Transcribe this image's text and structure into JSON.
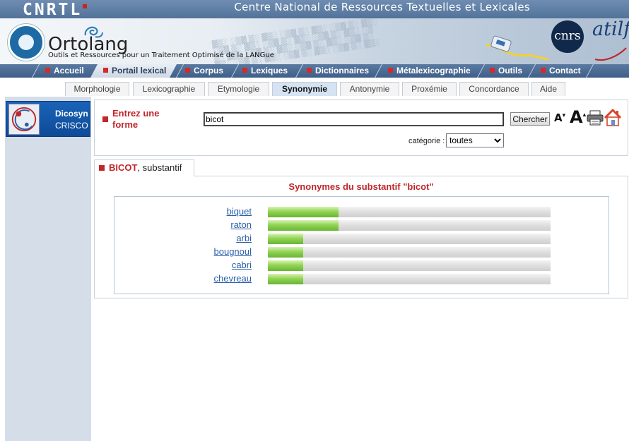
{
  "header": {
    "logo": "CNRTL",
    "title": "Centre National de Ressources Textuelles et Lexicales",
    "ortolang": "Ortolang",
    "tagline": "Outils et Ressources pour un Traitement Optimisé de la LANGue",
    "cnrs": "cnrs",
    "atilf": "atilf"
  },
  "nav": [
    {
      "label": "Accueil",
      "active": false
    },
    {
      "label": "Portail lexical",
      "active": true
    },
    {
      "label": "Corpus",
      "active": false
    },
    {
      "label": "Lexiques",
      "active": false
    },
    {
      "label": "Dictionnaires",
      "active": false
    },
    {
      "label": "Métalexicographie",
      "active": false
    },
    {
      "label": "Outils",
      "active": false
    },
    {
      "label": "Contact",
      "active": false
    }
  ],
  "subtabs": [
    {
      "label": "Morphologie",
      "active": false
    },
    {
      "label": "Lexicographie",
      "active": false
    },
    {
      "label": "Etymologie",
      "active": false
    },
    {
      "label": "Synonymie",
      "active": true
    },
    {
      "label": "Antonymie",
      "active": false
    },
    {
      "label": "Proxémie",
      "active": false
    },
    {
      "label": "Concordance",
      "active": false
    },
    {
      "label": "Aide",
      "active": false
    }
  ],
  "sidebar": {
    "title": "Dicosyn",
    "subtitle": "CRISCO"
  },
  "search": {
    "label": "Entrez une forme",
    "value": "bicot",
    "button": "Chercher",
    "category_label": "catégorie :",
    "category_value": "toutes",
    "font_down": "A",
    "font_up": "A"
  },
  "result": {
    "tab_word": "BICOT",
    "tab_suffix": ", substantif",
    "heading": "Synonymes du substantif \"bicot\"",
    "synonyms": [
      {
        "word": "biquet",
        "score": 0.25
      },
      {
        "word": "raton",
        "score": 0.25
      },
      {
        "word": "arbi",
        "score": 0.125
      },
      {
        "word": "bougnoul",
        "score": 0.125
      },
      {
        "word": "cabri",
        "score": 0.125
      },
      {
        "word": "chevreau",
        "score": 0.125
      }
    ]
  },
  "colors": {
    "accent_red": "#c0262a",
    "nav_blue": "#3f5f88",
    "link_blue": "#2a5fa8",
    "bar_green": "#67b534"
  }
}
